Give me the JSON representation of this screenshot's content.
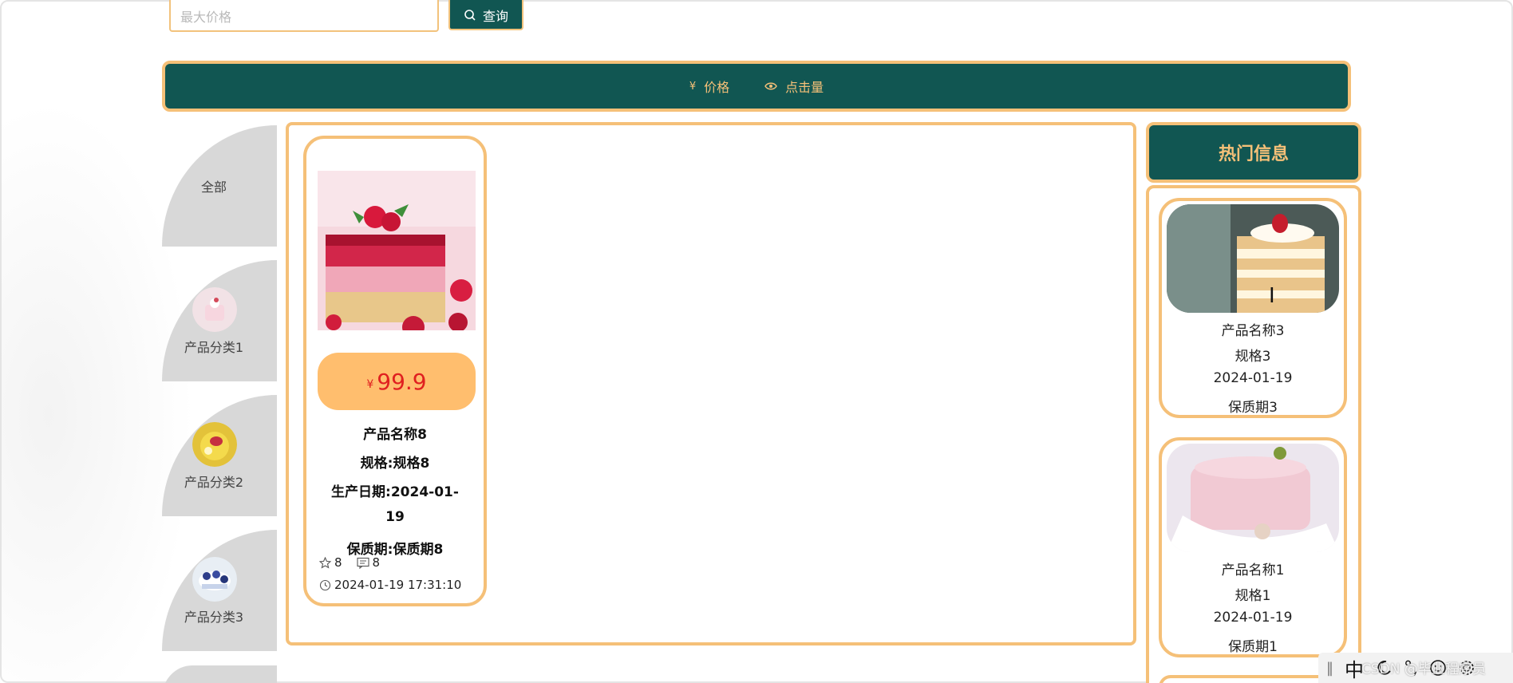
{
  "search": {
    "max_price_placeholder": "最大价格",
    "query_button": "查询"
  },
  "sort_bar": {
    "items": [
      {
        "icon": "¥",
        "label": "价格"
      },
      {
        "icon": "eye-icon",
        "label": "点击量"
      }
    ]
  },
  "categories": [
    {
      "label": "全部"
    },
    {
      "label": "产品分类1"
    },
    {
      "label": "产品分类2"
    },
    {
      "label": "产品分类3"
    }
  ],
  "products": [
    {
      "currency": "¥",
      "price": "99.9",
      "name": "产品名称8",
      "spec": "规格:规格8",
      "date_line1": "生产日期:2024-01-",
      "date_line2": "19",
      "shelf_life": "保质期:保质期8",
      "likes": "8",
      "comments": "8",
      "time": "2024-01-19 17:31:10"
    }
  ],
  "hot": {
    "title": "热门信息",
    "items": [
      {
        "name": "产品名称3",
        "spec": "规格3",
        "date": "2024-01-19",
        "shelf_life": "保质期3"
      },
      {
        "name": "产品名称1",
        "spec": "规格1",
        "date": "2024-01-19",
        "shelf_life": "保质期1"
      }
    ]
  },
  "ime": {
    "char": "中",
    "watermark": "CSDN @毕业程序员"
  },
  "colors": {
    "primary": "#115652",
    "accent": "#f5c078",
    "price_pill": "#ffbe6e",
    "price_text": "#e02020",
    "category_bg": "#d8d8d8"
  }
}
